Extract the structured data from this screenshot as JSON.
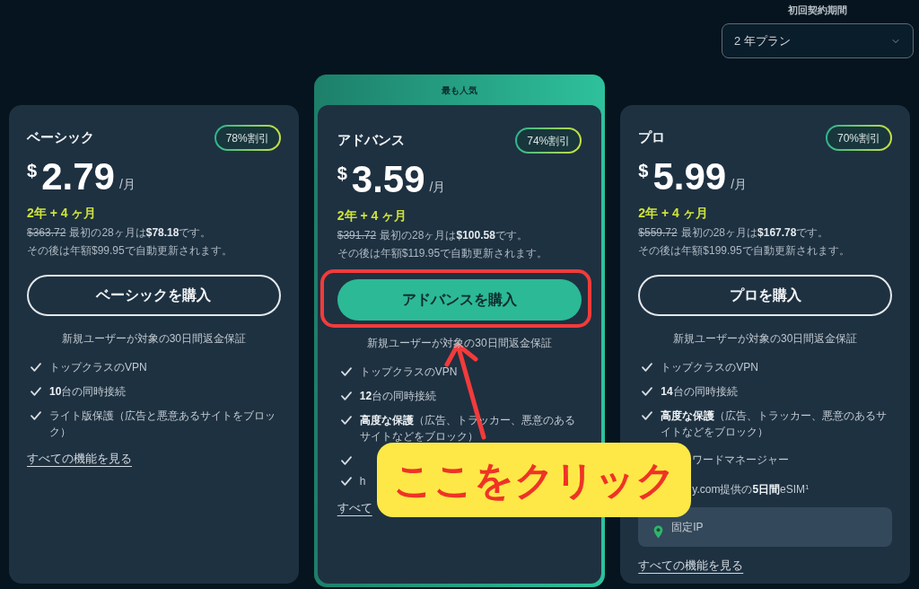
{
  "term_selector": {
    "label": "初回契約期間",
    "value": "2 年プラン"
  },
  "plans": [
    {
      "featured": false,
      "name": "ベーシック",
      "badge": "78%割引",
      "currency": "$",
      "price": "2.79",
      "unit": "/月",
      "term": "2年 + 4 ヶ月",
      "original_price": "$363.72",
      "first_charge": "最初の28ヶ月は**$78.18**です。",
      "renewal": "その後は年額$99.95で自動更新されます。",
      "button": "ベーシックを購入",
      "guarantee": "新規ユーザーが対象の30日間返金保証",
      "features": [
        {
          "kind": "check",
          "text": "トップクラスのVPN"
        },
        {
          "kind": "check",
          "text": "**10**台の同時接続"
        },
        {
          "kind": "check",
          "text": "ライト版保護（広告と悪意あるサイトをブロック）"
        }
      ],
      "link": "すべての機能を見る"
    },
    {
      "featured": true,
      "ribbon": "最も人気",
      "name": "アドバンス",
      "badge": "74%割引",
      "currency": "$",
      "price": "3.59",
      "unit": "/月",
      "term": "2年 + 4 ヶ月",
      "original_price": "$391.72",
      "first_charge": "最初の28ヶ月は**$100.58**です。",
      "renewal": "その後は年額$119.95で自動更新されます。",
      "button": "アドバンスを購入",
      "guarantee": "新規ユーザーが対象の30日間返金保証",
      "features": [
        {
          "kind": "check",
          "text": "トップクラスのVPN"
        },
        {
          "kind": "check",
          "text": "**12**台の同時接続"
        },
        {
          "kind": "check",
          "text": "**高度な保護**（広告、トラッカー、悪意のあるサイトなどをブロック）"
        },
        {
          "kind": "check"
        },
        {
          "kind": "check",
          "text": "h"
        }
      ],
      "link": "すべて"
    },
    {
      "featured": false,
      "name": "プロ",
      "badge": "70%割引",
      "currency": "$",
      "price": "5.99",
      "unit": "/月",
      "term": "2年 + 4 ヶ月",
      "original_price": "$559.72",
      "first_charge": "最初の28ヶ月は**$167.78**です。",
      "renewal": "その後は年額$199.95で自動更新されます。",
      "button": "プロを購入",
      "guarantee": "新規ユーザーが対象の30日間返金保証",
      "features": [
        {
          "kind": "check",
          "text": "トップクラスのVPN"
        },
        {
          "kind": "check",
          "text": "**14**台の同時接続"
        },
        {
          "kind": "check",
          "text": "**高度な保護**（広告、トラッカー、悪意のあるサイトなどをブロック）"
        },
        {
          "kind": "covered",
          "text": "ワードマネージャー"
        },
        {
          "kind": "covered",
          "text": "y.com提供の**5日間**eSIM$^{1}$"
        },
        {
          "kind": "highlight",
          "text": "固定IP"
        }
      ],
      "link": "すべての機能を見る"
    }
  ],
  "annotation": {
    "label": "ここをクリック"
  }
}
